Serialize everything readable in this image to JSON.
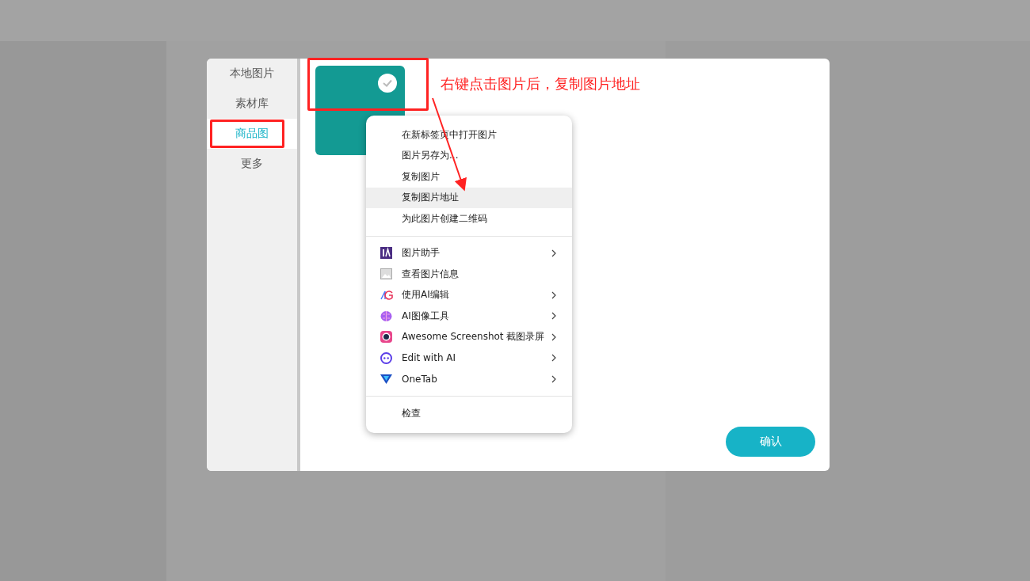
{
  "dialog": {
    "tabs": [
      {
        "label": "本地图片",
        "selected": false
      },
      {
        "label": "素材库",
        "selected": false
      },
      {
        "label": "商品图",
        "selected": true
      },
      {
        "label": "更多",
        "selected": false
      }
    ],
    "images": [
      {
        "checked": true
      }
    ],
    "confirm_button": "确认"
  },
  "context_menu": {
    "groups": [
      [
        {
          "label": "在新标签页中打开图片",
          "kind": "plain",
          "highlighted": false,
          "submenu": false
        },
        {
          "label": "图片另存为...",
          "kind": "plain",
          "highlighted": false,
          "submenu": false
        },
        {
          "label": "复制图片",
          "kind": "plain",
          "highlighted": false,
          "submenu": false
        },
        {
          "label": "复制图片地址",
          "kind": "plain",
          "highlighted": true,
          "submenu": false
        },
        {
          "label": "为此图片创建二维码",
          "kind": "plain",
          "highlighted": false,
          "submenu": false
        }
      ],
      [
        {
          "label": "图片助手",
          "kind": "assistant",
          "highlighted": false,
          "submenu": true
        },
        {
          "label": "查看图片信息",
          "kind": "info",
          "highlighted": false,
          "submenu": false
        },
        {
          "label": "使用AI编辑",
          "kind": "aiedit",
          "highlighted": false,
          "submenu": true
        },
        {
          "label": "AI图像工具",
          "kind": "aitools",
          "highlighted": false,
          "submenu": true
        },
        {
          "label": "Awesome Screenshot 截图录屏",
          "kind": "screenshot",
          "highlighted": false,
          "submenu": true
        },
        {
          "label": "Edit with AI",
          "kind": "editai",
          "highlighted": false,
          "submenu": true
        },
        {
          "label": "OneTab",
          "kind": "onetab",
          "highlighted": false,
          "submenu": true
        }
      ],
      [
        {
          "label": "检查",
          "kind": "plain",
          "highlighted": false,
          "submenu": false
        }
      ]
    ]
  },
  "annotation": {
    "text": "右键点击图片后，复制图片地址"
  }
}
